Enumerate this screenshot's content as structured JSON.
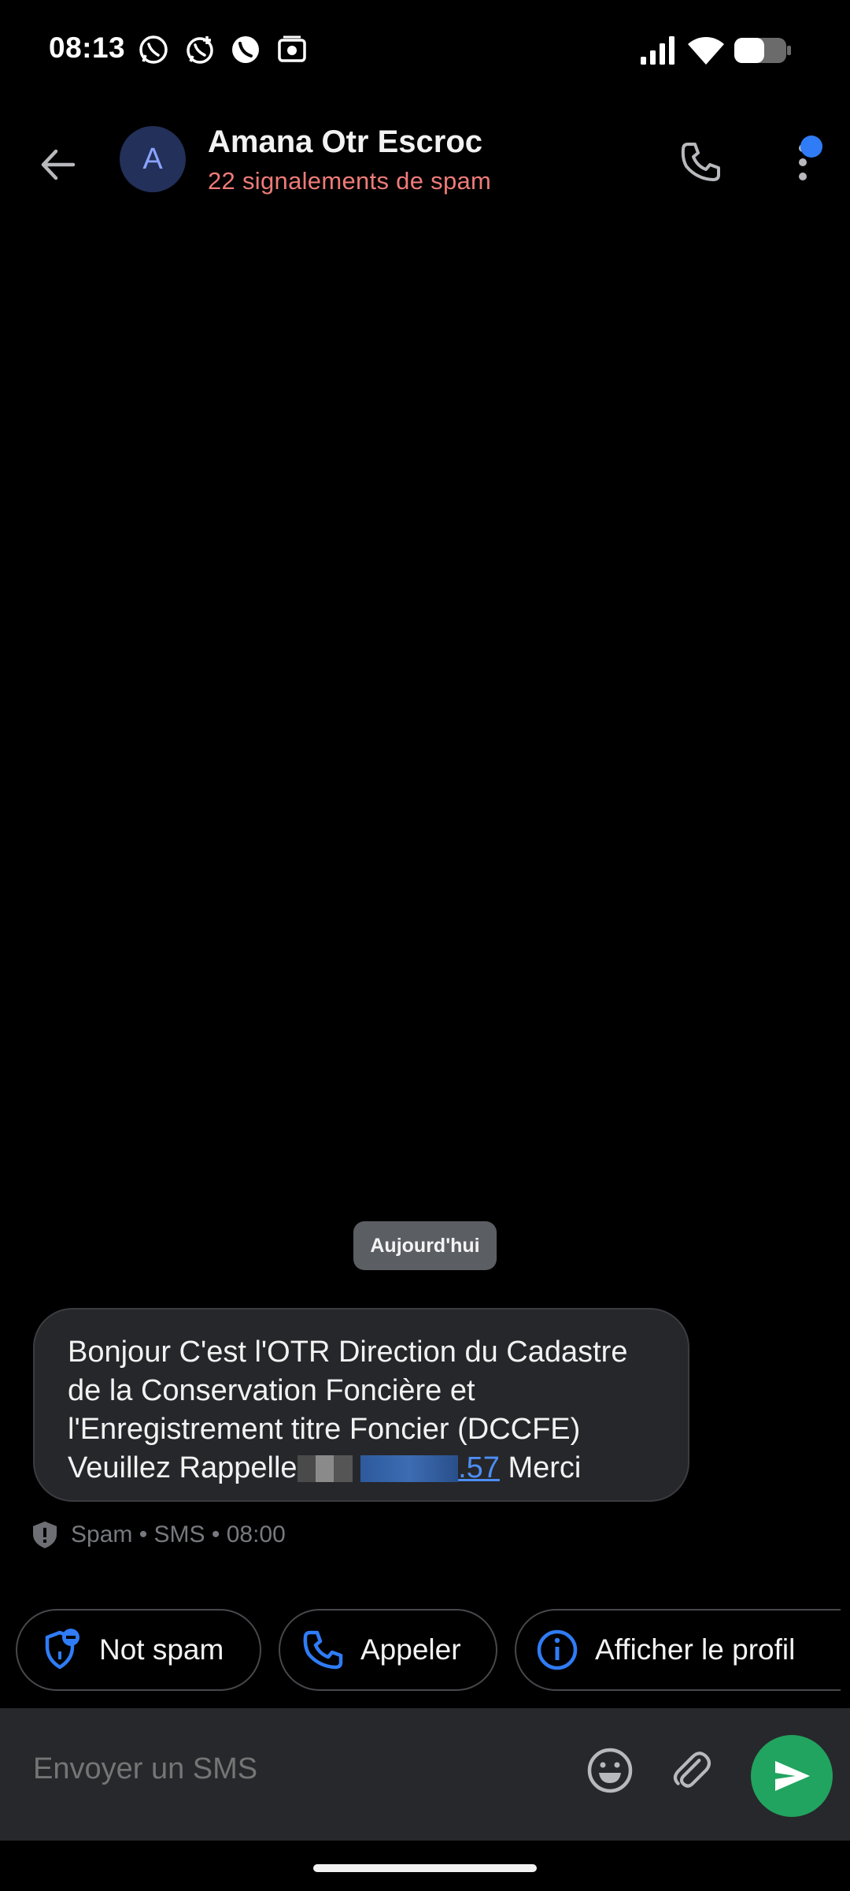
{
  "status_bar": {
    "time": "08:13",
    "left_icons": [
      "whatsapp-icon",
      "whatsapp-business-icon",
      "viber-icon",
      "radio-icon"
    ],
    "right_icons": [
      "signal-icon",
      "wifi-icon",
      "battery-icon"
    ]
  },
  "header": {
    "avatar_letter": "A",
    "contact_name": "Amana Otr Escroc",
    "subtitle": "22 signalements de spam"
  },
  "conversation": {
    "date_chip": "Aujourd'hui",
    "message": {
      "text_before": "Bonjour C'est l'OTR  Direction du Cadastre de la Conservation Foncière et l'Enregistrement titre Foncier (DCCFE) Veuillez Rappelle",
      "link_visible": ".57",
      "text_after": " Merci"
    },
    "meta": "Spam • SMS • 08:00"
  },
  "actions": {
    "not_spam": "Not spam",
    "call": "Appeler",
    "profile": "Afficher le profil"
  },
  "compose": {
    "placeholder": "Envoyer un SMS"
  },
  "colors": {
    "accent_blue": "#2f7cf6",
    "spam_red": "#ee7b78",
    "send_green": "#21a45f",
    "bubble": "#26272b"
  }
}
